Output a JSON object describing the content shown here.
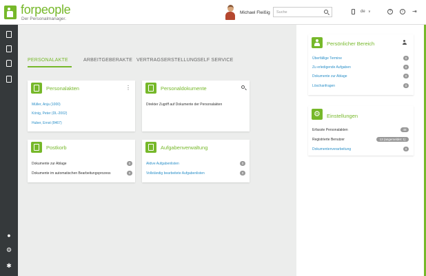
{
  "app": {
    "logo_text": "forpeople",
    "logo_subtitle": "Der Personalmanager.",
    "user_name": "Michael Fleißig"
  },
  "header": {
    "search_placeholder": "Suche",
    "language": "de",
    "language_chevron": "∨",
    "help_symbol": "?",
    "info_symbol": "i",
    "logout_symbol": "⇥"
  },
  "tabs": [
    {
      "label": "PERSONALAKTE",
      "active": true
    },
    {
      "label": "ARBEITGEBERAKTE",
      "active": false
    },
    {
      "label": "VERTRAGSERSTELLUNG",
      "active": false
    },
    {
      "label": "SELF SERVICE",
      "active": false
    }
  ],
  "personalakten": {
    "title": "Personalakten",
    "menu_symbol": "⋮",
    "links": [
      "Müller, Anja (1000)",
      "König, Peter (DL-2002)",
      "Huber, Ernst (8467)"
    ]
  },
  "personaldokumente": {
    "title": "Personaldokumente",
    "description": "Direkter Zugriff auf Dokumente der Personalakten"
  },
  "postkorb": {
    "title": "Postkorb",
    "items": [
      {
        "label": "Dokumente zur Ablage",
        "count": "0"
      },
      {
        "label": "Dokumente im automatischen Bearbeitungsprozess",
        "count": "0"
      }
    ]
  },
  "aufgabenverwaltung": {
    "title": "Aufgabenverwaltung",
    "items": [
      {
        "label": "Aktive Aufgabenlisten",
        "count": "0"
      },
      {
        "label": "Vollständig bearbeitete Aufgabenlisten",
        "count": "0"
      }
    ]
  },
  "persoenlicher_bereich": {
    "title": "Persönlicher Bereich",
    "items": [
      {
        "label": "Überfällige Termine",
        "count": "0"
      },
      {
        "label": "Zu erledigende Aufgaben",
        "count": "0"
      },
      {
        "label": "Dokumente zur Ablage",
        "count": "0"
      },
      {
        "label": "Löschanfragen",
        "count": "0"
      }
    ]
  },
  "einstellungen": {
    "title": "Einstellungen",
    "items": [
      {
        "label": "Erfasste Personalakten",
        "count": "48"
      },
      {
        "label": "Registrierte Benutzer",
        "count": "13 (angemeldet: 1)"
      },
      {
        "label": "Dokumentenverarbeitung",
        "count": "0"
      }
    ]
  },
  "colors": {
    "brand_green": "#76b82a",
    "link_blue": "#2a8fc8",
    "sidebar_dark": "#35393b"
  }
}
